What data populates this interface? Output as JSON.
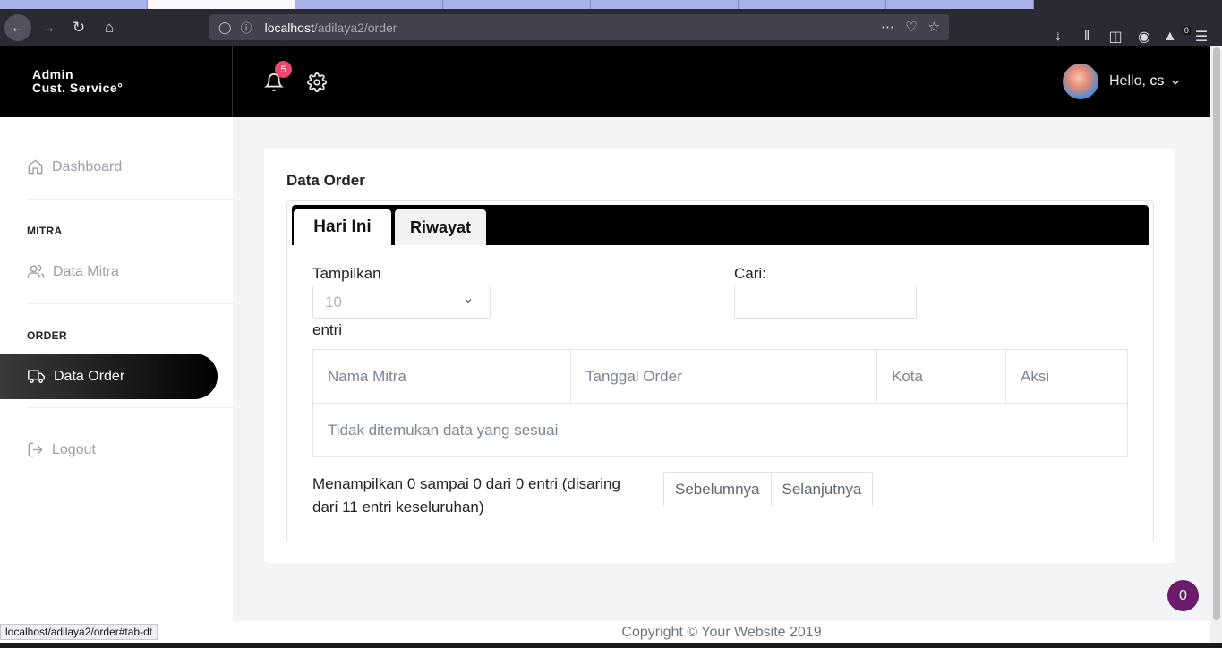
{
  "browser": {
    "url_host": "localhost",
    "url_path": "/adilaya2/order",
    "ext_badge": "0",
    "status_url": "localhost/adilaya2/order#tab-dt"
  },
  "header": {
    "brand_line1": "Admin",
    "brand_line2": "Cust. Service°",
    "notification_count": "5",
    "greeting": "Hello,",
    "username": "cs"
  },
  "sidebar": {
    "dashboard": "Dashboard",
    "section_mitra": "MITRA",
    "data_mitra": "Data Mitra",
    "section_order": "ORDER",
    "data_order": "Data Order",
    "logout": "Logout"
  },
  "main": {
    "title": "Data Order",
    "tabs": [
      {
        "label": "Hari Ini"
      },
      {
        "label": "Riwayat"
      }
    ],
    "length_label": "Tampilkan",
    "length_value": "10",
    "length_suffix": "entri",
    "search_label": "Cari:",
    "columns": [
      "Nama Mitra",
      "Tanggal Order",
      "Kota",
      "Aksi"
    ],
    "empty_message": "Tidak ditemukan data yang sesuai",
    "info": "Menampilkan 0 sampai 0 dari 0 entri (disaring dari 11 entri keseluruhan)",
    "prev": "Sebelumnya",
    "next": "Selanjutnya"
  },
  "footer": {
    "copyright": "Copyright © Your Website 2019"
  },
  "chat_count": "0",
  "colors": {
    "header_bg": "#000000",
    "badge": "#f0456b",
    "fab": "#6a1b6a"
  }
}
